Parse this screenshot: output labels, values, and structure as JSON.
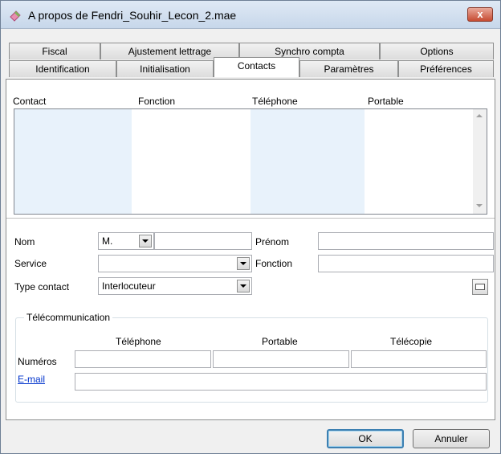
{
  "window": {
    "title": "A propos de Fendri_Souhir_Lecon_2.mae",
    "close_label": "x",
    "icon": "app-icon"
  },
  "tabs": {
    "row1": [
      "Fiscal",
      "Ajustement lettrage",
      "Synchro compta",
      "Options"
    ],
    "row2": [
      "Identification",
      "Initialisation",
      "Contacts",
      "Paramètres",
      "Préférences"
    ],
    "active": "Contacts"
  },
  "contacts_list": {
    "columns": [
      "Contact",
      "Fonction",
      "Téléphone",
      "Portable"
    ],
    "rows": []
  },
  "form": {
    "nom_label": "Nom",
    "civilite_value": "M.",
    "nom_value": "",
    "prenom_label": "Prénom",
    "prenom_value": "",
    "service_label": "Service",
    "service_value": "",
    "fonction_label": "Fonction",
    "fonction_value": "",
    "type_contact_label": "Type contact",
    "type_contact_value": "Interlocuteur"
  },
  "telecom": {
    "group_label": "Télécommunication",
    "col_telephone": "Téléphone",
    "col_portable": "Portable",
    "col_telecopie": "Télécopie",
    "numeros_label": "Numéros",
    "email_label": "E-mail",
    "telephone_value": "",
    "portable_value": "",
    "telecopie_value": "",
    "email_value": ""
  },
  "buttons": {
    "ok": "OK",
    "cancel": "Annuler"
  },
  "colors": {
    "accent_list_column": "#e8f2fb",
    "link": "#0033cc"
  }
}
